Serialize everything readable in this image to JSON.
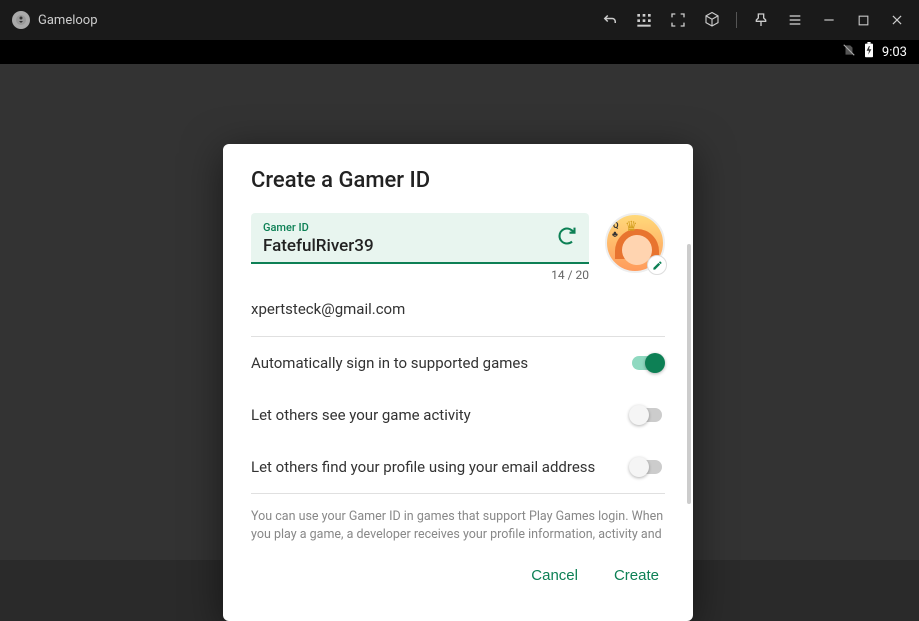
{
  "titlebar": {
    "app_name": "Gameloop"
  },
  "statusbar": {
    "time": "9:03"
  },
  "dialog": {
    "title": "Create a Gamer ID",
    "gamer_id": {
      "label": "Gamer ID",
      "value": "FatefulRiver39",
      "counter": "14 / 20"
    },
    "avatar": {
      "card_rank": "Q",
      "card_suit": "♣"
    },
    "email": "xpertsteck@gmail.com",
    "toggles": [
      {
        "label": "Automatically sign in to supported games",
        "on": true
      },
      {
        "label": "Let others see your game activity",
        "on": false
      },
      {
        "label": "Let others find your profile using your email address",
        "on": false
      }
    ],
    "help_text": "You can use your Gamer ID in games that support Play Games login. When you play a game, a developer receives your profile information, activity and",
    "actions": {
      "cancel": "Cancel",
      "create": "Create"
    }
  }
}
